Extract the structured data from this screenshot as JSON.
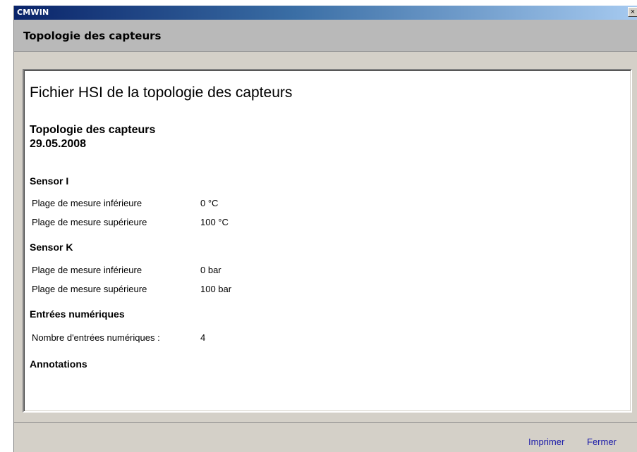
{
  "window": {
    "title": "CMWIN",
    "close_glyph": "×"
  },
  "header": {
    "title": "Topologie des capteurs"
  },
  "report": {
    "heading": "Fichier HSI de la topologie des capteurs",
    "subtitle_line1": "Topologie des capteurs",
    "subtitle_line2": "29.05.2008",
    "sections": [
      {
        "title": "Sensor I",
        "rows": [
          {
            "label": "Plage de mesure inférieure",
            "value": "0 °C"
          },
          {
            "label": "Plage de mesure supérieure",
            "value": "100 °C"
          }
        ]
      },
      {
        "title": "Sensor K",
        "rows": [
          {
            "label": "Plage de mesure inférieure",
            "value": "0 bar"
          },
          {
            "label": "Plage de mesure supérieure",
            "value": "100 bar"
          }
        ]
      },
      {
        "title": "Entrées numériques",
        "rows": [
          {
            "label": "Nombre d'entrées numériques :",
            "value": "4"
          }
        ]
      },
      {
        "title": "Annotations",
        "rows": []
      }
    ]
  },
  "footer": {
    "print_label": "Imprimer",
    "close_label": "Fermer"
  },
  "colors": {
    "titlebar_start": "#0a246a",
    "titlebar_end": "#a6caf0",
    "link": "#1a1aa8",
    "header_band": "#b9b9b9",
    "frame": "#d4d0c8"
  }
}
